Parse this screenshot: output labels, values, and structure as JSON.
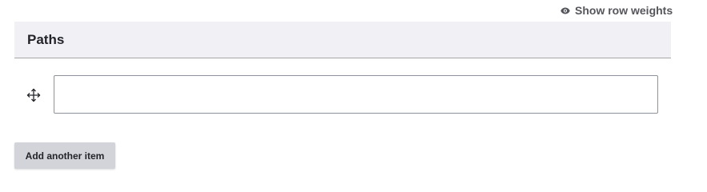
{
  "toolbar": {
    "row_weights_label": "Show row weights",
    "row_weights_icon": "eye-icon"
  },
  "field": {
    "title": "Paths",
    "rows": [
      {
        "drag_icon": "move-arrows-icon",
        "value": "",
        "placeholder": ""
      }
    ],
    "add_button_label": "Add another item"
  },
  "colors": {
    "header_background": "#f0f0f5",
    "button_background": "#d3d4d9",
    "text": "#232429",
    "muted_text": "#55565b"
  }
}
